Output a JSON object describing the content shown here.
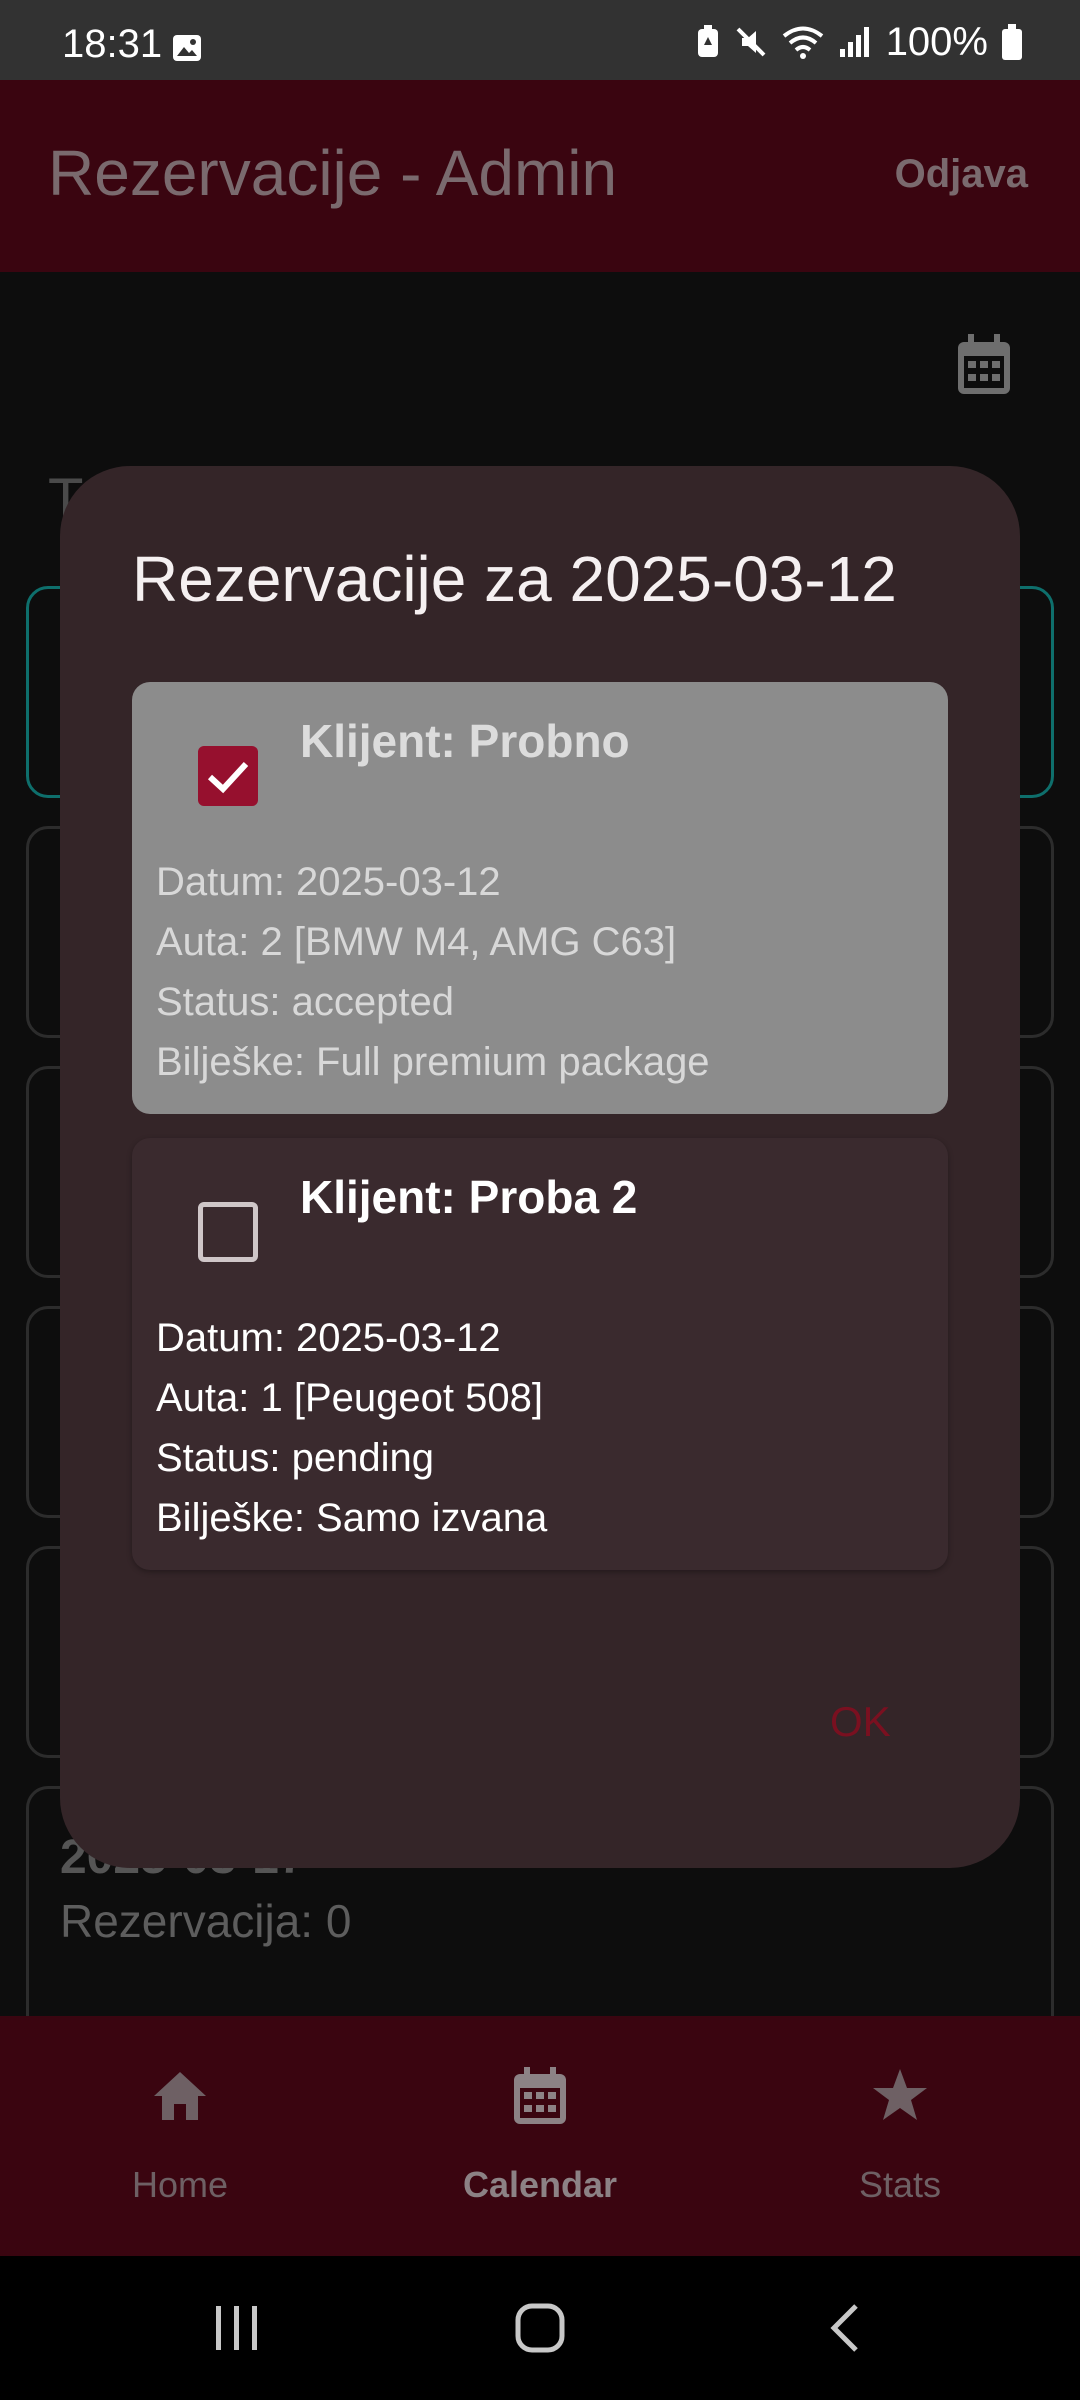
{
  "status_bar": {
    "time": "18:31",
    "battery": "100%",
    "icons": [
      "image-icon",
      "battery-saver-icon",
      "mute-icon",
      "wifi-icon",
      "signal-icon",
      "battery-icon"
    ]
  },
  "app_bar": {
    "title": "Rezervacije - Admin",
    "logout_label": "Odjava"
  },
  "background": {
    "heading_partial": "T",
    "last_card_date": "2025-03-17",
    "last_card_count": "Rezervacija: 0"
  },
  "dialog": {
    "title": "Rezervacije za 2025-03-12",
    "reservations": [
      {
        "checked": true,
        "client": "Klijent: Probno",
        "date": "Datum: 2025-03-12",
        "cars": "Auta: 2 [BMW M4, AMG C63]",
        "status": "Status: accepted",
        "notes": "Bilješke: Full premium package"
      },
      {
        "checked": false,
        "client": "Klijent: Proba 2",
        "date": "Datum: 2025-03-12",
        "cars": "Auta: 1 [Peugeot 508]",
        "status": "Status: pending",
        "notes": "Bilješke: Samo izvana"
      }
    ],
    "ok_label": "OK"
  },
  "bottom_nav": {
    "items": [
      {
        "label": "Home",
        "icon": "home-icon"
      },
      {
        "label": "Calendar",
        "icon": "calendar-icon",
        "active": true
      },
      {
        "label": "Stats",
        "icon": "star-icon"
      }
    ]
  },
  "colors": {
    "app_bar": "#3a0510",
    "dialog": "#342528",
    "accent": "#96102e",
    "selected_border": "#0e6f6c"
  }
}
